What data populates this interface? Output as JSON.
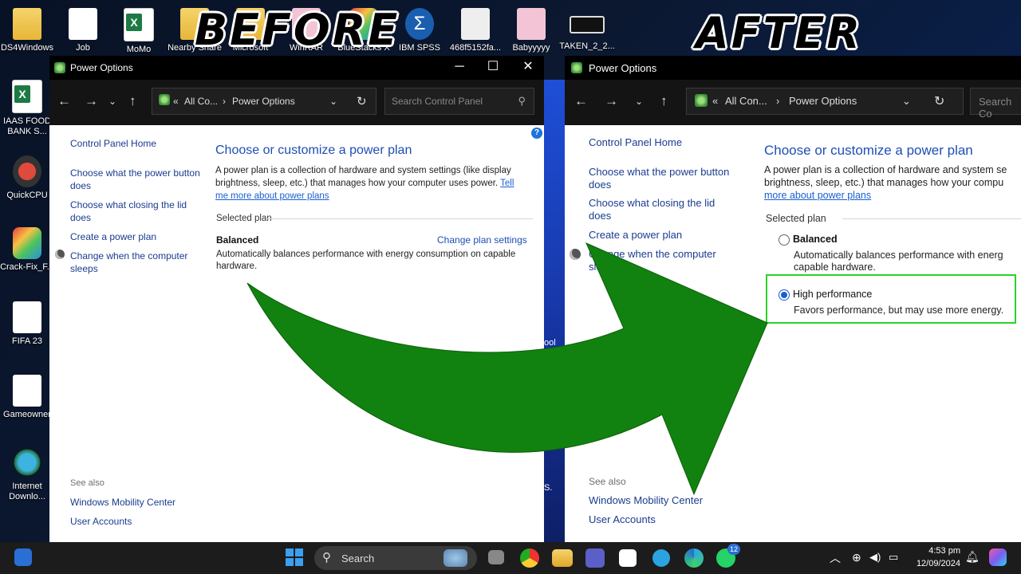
{
  "overlay": {
    "before": "BEFORE",
    "after": "AFTER"
  },
  "desktop_icons": [
    {
      "label": "DS4Windows"
    },
    {
      "label": "Job"
    },
    {
      "label": "MoMo"
    },
    {
      "label": "Nearby Share"
    },
    {
      "label": "Microsoft"
    },
    {
      "label": "WinRAR"
    },
    {
      "label": "BlueStacks X"
    },
    {
      "label": "IBM SPSS"
    },
    {
      "label": "468f5152fa..."
    },
    {
      "label": "Babyyyyy"
    },
    {
      "label": "TAKEN_2_2..."
    },
    {
      "label": "IAAS FOOD BANK S..."
    },
    {
      "label": "QuickCPU"
    },
    {
      "label": "Crack-Fix_F..."
    },
    {
      "label": "FIFA 23"
    },
    {
      "label": "Gameowner"
    },
    {
      "label": "Internet Downlo..."
    }
  ],
  "window": {
    "title": "Power Options",
    "minimize": "─",
    "maximize": "☐",
    "close": "✕",
    "breadcrumb_prefix": "«",
    "breadcrumb_root_before": "All Co...",
    "breadcrumb_root_after": "All Con...",
    "breadcrumb_sep": "›",
    "breadcrumb_current": "Power Options",
    "search_placeholder": "Search Control Panel",
    "search_placeholder_after": "Search Co",
    "help": "?",
    "sidebar": {
      "home": "Control Panel Home",
      "items": [
        "Choose what the power button does",
        "Choose what closing the lid does",
        "Create a power plan",
        "Change when the computer sleeps"
      ],
      "see_also": "See also",
      "see_also_items": [
        "Windows Mobility Center",
        "User Accounts"
      ]
    },
    "main": {
      "heading": "Choose or customize a power plan",
      "intro": "A power plan is a collection of hardware and system settings (like display brightness, sleep, etc.) that manages how your computer uses power.",
      "intro_link": "Tell me more about power plans",
      "intro_after_line1": "A power plan is a collection of hardware and system se",
      "intro_after_line2": "brightness, sleep, etc.) that manages how your compu",
      "intro_after_link": "more about power plans",
      "selected_plan": "Selected plan",
      "plans": [
        {
          "name": "Balanced",
          "desc": "Automatically balances performance with energy consumption on capable hardware.",
          "desc_after_1": "Automatically balances performance with energ",
          "desc_after_2": "capable hardware."
        },
        {
          "name": "High performance",
          "desc": "Favors performance, but may use more energy."
        }
      ],
      "change_settings": "Change plan settings",
      "selected_after": "High performance"
    }
  },
  "behind_text": {
    "a": "ool",
    "b": "S."
  },
  "taskbar": {
    "search": "Search",
    "time": "4:53 pm",
    "date": "12/09/2024",
    "badge": "12"
  }
}
